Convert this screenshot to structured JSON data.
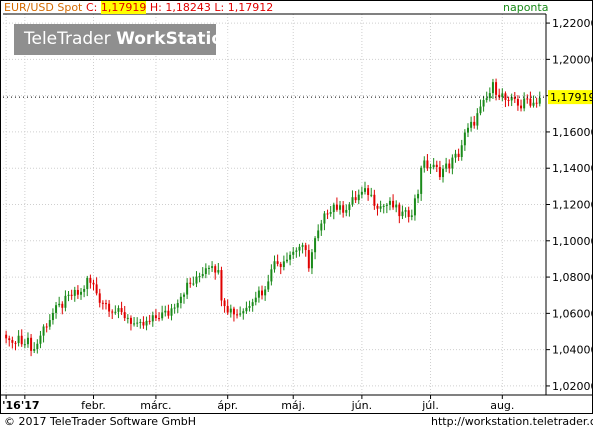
{
  "header": {
    "instrument": "EUR/USD Spot",
    "close_label": "C:",
    "close_value": "1,17919",
    "high_label": "H:",
    "high_value": "1,18243",
    "low_label": "L:",
    "low_value": "1,17912",
    "period": "naponta"
  },
  "brand": {
    "part1": "TeleTrader ",
    "part2": "WorkStation"
  },
  "footer": {
    "copyright": "© 2017 TeleTrader Software GmbH",
    "url": "http://workstation.teletrader.com/"
  },
  "colors": {
    "up": "#1a8a1a",
    "down": "#e00000",
    "last_price_bg": "#ffff00",
    "brand_bg": "#8f8f8f"
  },
  "chart_data": {
    "type": "candlestick",
    "title": "EUR/USD Spot",
    "interval": "naponta",
    "ylim": [
      1.015,
      1.225
    ],
    "y_ticks": [
      "1,02000",
      "1,04000",
      "1,06000",
      "1,08000",
      "1,10000",
      "1,12000",
      "1,14000",
      "1,16000",
      "1,18000",
      "1,20000",
      "1,22000"
    ],
    "y_tick_values": [
      1.02,
      1.04,
      1.06,
      1.08,
      1.1,
      1.12,
      1.14,
      1.16,
      1.18,
      1.2,
      1.22
    ],
    "x_ticks": [
      "'16",
      "'17",
      "febr.",
      "márc.",
      "ápr.",
      "máj.",
      "jún.",
      "júl.",
      "aug."
    ],
    "x_tick_day_index": [
      -6,
      0,
      22,
      42,
      65,
      86,
      108,
      130,
      153
    ],
    "last_price": "1,17919",
    "last_price_value": 1.17919,
    "ohlc_anchor_closes": [
      [
        -6,
        1.047
      ],
      [
        -4,
        1.043
      ],
      [
        -2,
        1.045
      ],
      [
        0,
        1.046
      ],
      [
        3,
        1.04
      ],
      [
        6,
        1.052
      ],
      [
        9,
        1.06
      ],
      [
        12,
        1.065
      ],
      [
        15,
        1.07
      ],
      [
        18,
        1.071
      ],
      [
        20,
        1.078
      ],
      [
        22,
        1.075
      ],
      [
        24,
        1.068
      ],
      [
        27,
        1.064
      ],
      [
        30,
        1.06
      ],
      [
        33,
        1.058
      ],
      [
        36,
        1.052
      ],
      [
        40,
        1.055
      ],
      [
        43,
        1.059
      ],
      [
        46,
        1.06
      ],
      [
        49,
        1.068
      ],
      [
        52,
        1.075
      ],
      [
        55,
        1.078
      ],
      [
        58,
        1.086
      ],
      [
        60,
        1.088
      ],
      [
        62,
        1.082
      ],
      [
        63,
        1.07
      ],
      [
        65,
        1.063
      ],
      [
        68,
        1.06
      ],
      [
        71,
        1.063
      ],
      [
        73,
        1.069
      ],
      [
        75,
        1.072
      ],
      [
        77,
        1.072
      ],
      [
        79,
        1.087
      ],
      [
        82,
        1.088
      ],
      [
        84,
        1.092
      ],
      [
        86,
        1.094
      ],
      [
        88,
        1.097
      ],
      [
        90,
        1.093
      ],
      [
        91,
        1.087
      ],
      [
        93,
        1.1
      ],
      [
        95,
        1.108
      ],
      [
        97,
        1.117
      ],
      [
        99,
        1.12
      ],
      [
        101,
        1.117
      ],
      [
        104,
        1.12
      ],
      [
        107,
        1.125
      ],
      [
        110,
        1.127
      ],
      [
        112,
        1.122
      ],
      [
        114,
        1.119
      ],
      [
        116,
        1.12
      ],
      [
        118,
        1.119
      ],
      [
        120,
        1.115
      ],
      [
        122,
        1.114
      ],
      [
        124,
        1.117
      ],
      [
        126,
        1.127
      ],
      [
        127,
        1.142
      ],
      [
        130,
        1.141
      ],
      [
        133,
        1.138
      ],
      [
        136,
        1.142
      ],
      [
        139,
        1.148
      ],
      [
        141,
        1.158
      ],
      [
        144,
        1.166
      ],
      [
        146,
        1.172
      ],
      [
        148,
        1.178
      ],
      [
        150,
        1.185
      ],
      [
        153,
        1.18
      ],
      [
        155,
        1.175
      ],
      [
        157,
        1.178
      ],
      [
        159,
        1.174
      ],
      [
        161,
        1.178
      ],
      [
        163,
        1.176
      ],
      [
        165,
        1.179
      ]
    ]
  }
}
